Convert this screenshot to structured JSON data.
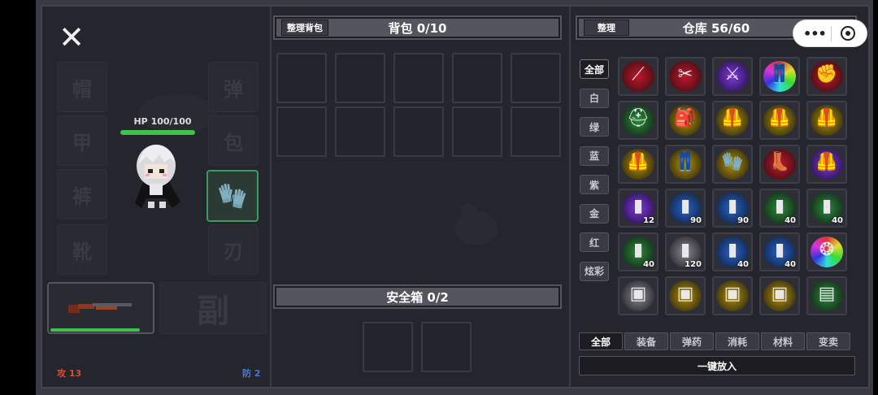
{
  "equipment": {
    "slots_left": [
      "帽",
      "甲",
      "裤",
      "靴"
    ],
    "slots_right": [
      "弹",
      "包",
      "刃"
    ],
    "hp": "HP 100/100",
    "hp_fraction": 1.0,
    "secondary_slot": "副",
    "attack": "攻 13",
    "defense": "防 2",
    "glove_icon": "gloves-icon",
    "weapon_icon": "shotgun-icon",
    "weapon_durability": 0.9
  },
  "backpack": {
    "sort_label": "整理背包",
    "title": "背包 0/10"
  },
  "safe_box": {
    "title": "安全箱 0/2"
  },
  "warehouse": {
    "sort_label": "整理",
    "title": "仓库 56/60",
    "rarity_filters": [
      "全部",
      "白",
      "绿",
      "蓝",
      "紫",
      "金",
      "红",
      "炫彩"
    ],
    "category_tabs": [
      "全部",
      "装备",
      "弹药",
      "消耗",
      "材料",
      "变卖"
    ],
    "put_all_label": "一键放入",
    "items": [
      {
        "icon": "red-spear-icon",
        "glyph": "⟋",
        "rarity": "red",
        "count": ""
      },
      {
        "icon": "red-scissors-icon",
        "glyph": "✂",
        "rarity": "red",
        "count": ""
      },
      {
        "icon": "purple-sword-icon",
        "glyph": "⚔",
        "rarity": "purple",
        "count": ""
      },
      {
        "icon": "rainbow-pants-icon",
        "glyph": "👖",
        "rarity": "rainbow",
        "count": ""
      },
      {
        "icon": "red-gauntlet-icon",
        "glyph": "✊",
        "rarity": "red",
        "count": ""
      },
      {
        "icon": "green-helmet-icon",
        "glyph": "⛑",
        "rarity": "green",
        "count": ""
      },
      {
        "icon": "gold-backpack-icon",
        "glyph": "🎒",
        "rarity": "gold",
        "count": ""
      },
      {
        "icon": "gold-vest-icon",
        "glyph": "🦺",
        "rarity": "gold",
        "count": ""
      },
      {
        "icon": "gold-vest-icon",
        "glyph": "🦺",
        "rarity": "gold",
        "count": ""
      },
      {
        "icon": "gold-armor-icon",
        "glyph": "🦺",
        "rarity": "gold",
        "count": ""
      },
      {
        "icon": "gold-armor-icon",
        "glyph": "🦺",
        "rarity": "gold",
        "count": ""
      },
      {
        "icon": "gold-jeans-icon",
        "glyph": "👖",
        "rarity": "gold",
        "count": ""
      },
      {
        "icon": "gold-gloves-icon",
        "glyph": "🧤",
        "rarity": "gold",
        "count": ""
      },
      {
        "icon": "red-boots-icon",
        "glyph": "👢",
        "rarity": "red",
        "count": ""
      },
      {
        "icon": "purple-armor-icon",
        "glyph": "🦺",
        "rarity": "purple",
        "count": ""
      },
      {
        "icon": "red-shell-icon",
        "glyph": "▮",
        "rarity": "purple",
        "count": "12"
      },
      {
        "icon": "bullet-icon",
        "glyph": "▮",
        "rarity": "blue",
        "count": "90"
      },
      {
        "icon": "bullet-icon",
        "glyph": "▮",
        "rarity": "blue",
        "count": "90"
      },
      {
        "icon": "red-shell-icon",
        "glyph": "▮",
        "rarity": "green",
        "count": "40"
      },
      {
        "icon": "red-shell-icon",
        "glyph": "▮",
        "rarity": "green",
        "count": "40"
      },
      {
        "icon": "red-shell-icon",
        "glyph": "▮",
        "rarity": "green",
        "count": "40"
      },
      {
        "icon": "bullet-icon",
        "glyph": "▮",
        "rarity": "white",
        "count": "120"
      },
      {
        "icon": "red-shell-icon",
        "glyph": "▮",
        "rarity": "blue",
        "count": "40"
      },
      {
        "icon": "red-shell-icon",
        "glyph": "▮",
        "rarity": "blue",
        "count": "40"
      },
      {
        "icon": "purple-grenade-icon",
        "glyph": "❂",
        "rarity": "rainbow",
        "count": ""
      },
      {
        "icon": "food-box-icon",
        "glyph": "▣",
        "rarity": "white",
        "count": ""
      },
      {
        "icon": "red-case-icon",
        "glyph": "▣",
        "rarity": "gold",
        "count": ""
      },
      {
        "icon": "red-case-icon",
        "glyph": "▣",
        "rarity": "gold",
        "count": ""
      },
      {
        "icon": "metal-crate-icon",
        "glyph": "▣",
        "rarity": "gold",
        "count": ""
      },
      {
        "icon": "green-radio-icon",
        "glyph": "▤",
        "rarity": "green",
        "count": ""
      }
    ]
  },
  "colors": {
    "red": "#c0182b",
    "purple": "#6d2cc9",
    "gold": "#c8a000",
    "green": "#2e8b3e",
    "blue": "#2a63c9",
    "white": "#9a9aa0",
    "hp": "#3fc24a",
    "attack": "#d0503a",
    "defense": "#4a7ad8"
  }
}
